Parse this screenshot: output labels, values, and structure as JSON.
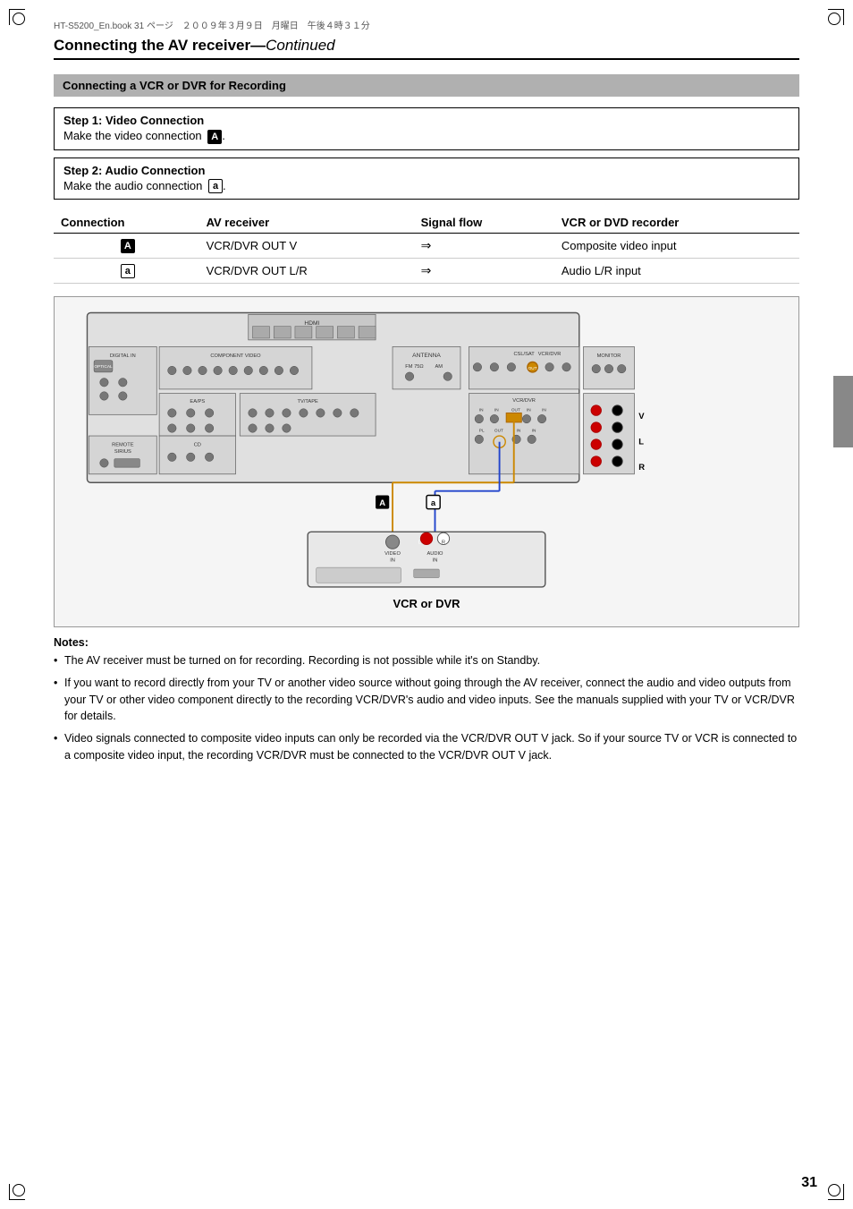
{
  "fileHeader": "HT-S5200_En.book  31 ページ　２００９年３月９日　月曜日　午後４時３１分",
  "pageTitle": {
    "main": "Connecting the AV receiver",
    "continued": "Continued"
  },
  "sectionHeader": "Connecting a VCR or DVR for Recording",
  "steps": [
    {
      "title": "Step 1: Video Connection",
      "desc": "Make the video connection",
      "badgeType": "filled",
      "badgeLabel": "A"
    },
    {
      "title": "Step 2: Audio Connection",
      "desc": "Make the audio connection",
      "badgeType": "outline",
      "badgeLabel": "a"
    }
  ],
  "table": {
    "headers": [
      "Connection",
      "AV receiver",
      "Signal flow",
      "VCR or DVD recorder"
    ],
    "rows": [
      {
        "connection": "A",
        "connectionType": "filled",
        "avReceiver": "VCR/DVR OUT V",
        "signal": "⇒",
        "vcrDvd": "Composite video input"
      },
      {
        "connection": "a",
        "connectionType": "outline",
        "avReceiver": "VCR/DVR OUT L/R",
        "signal": "⇒",
        "vcrDvd": "Audio L/R input"
      }
    ]
  },
  "diagram": {
    "vcrLabel": "VCR or DVR"
  },
  "notes": {
    "title": "Notes:",
    "items": [
      "The AV receiver must be turned on for recording. Recording is not possible while it's on Standby.",
      "If you want to record directly from your TV or another video source without going through the AV receiver, connect the audio and video outputs from your TV or other video component directly to the recording VCR/DVR's audio and video inputs. See the manuals supplied with your TV or VCR/DVR for details.",
      "Video signals connected to composite video inputs can only be recorded via the VCR/DVR OUT V jack. So if your source TV or VCR is connected to a composite video input, the recording VCR/DVR must be connected to the VCR/DVR OUT V jack."
    ]
  },
  "pageNumber": "31"
}
